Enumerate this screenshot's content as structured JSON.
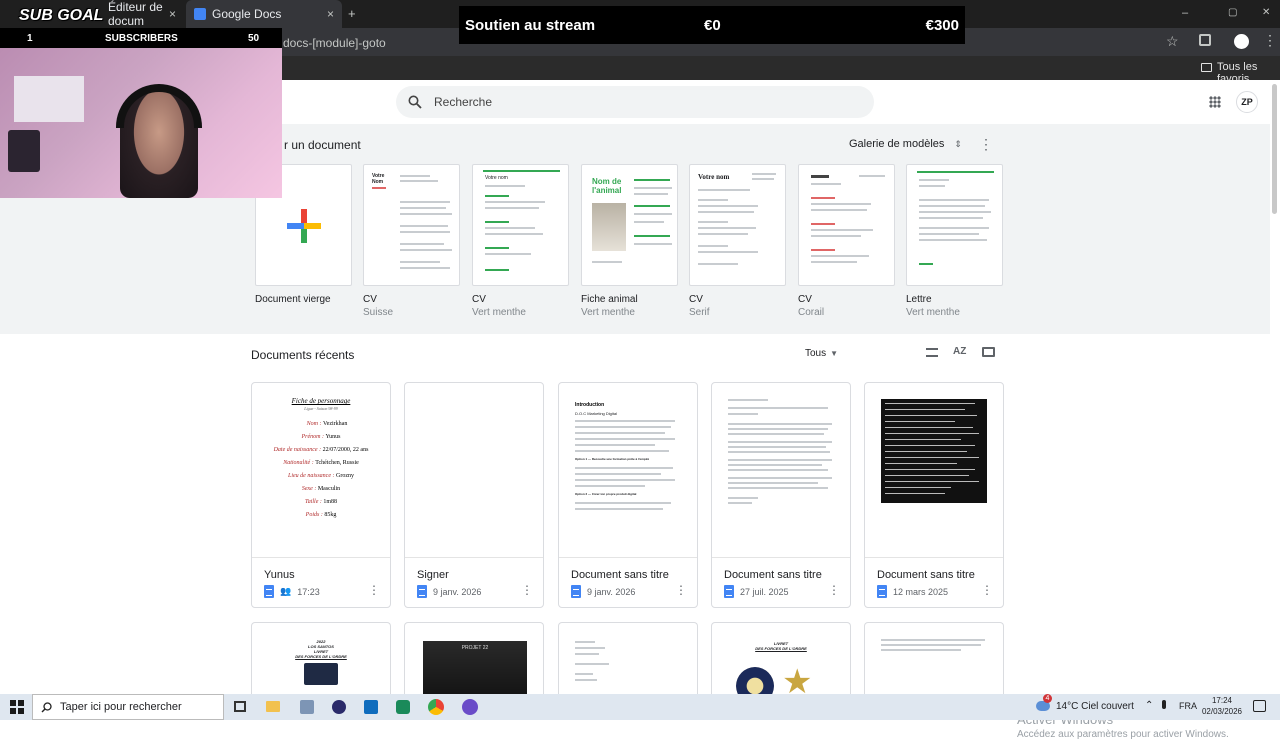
{
  "browser": {
    "tabs": [
      {
        "label": "Éditeur de docum",
        "close": "×"
      },
      {
        "label": "Google Docs",
        "close": "×"
      }
    ],
    "new_tab": "+",
    "url": "docs-[module]-goto",
    "bookmarks_label": "Tous les favoris",
    "window_controls": [
      "–",
      "▢",
      "✕"
    ]
  },
  "docs": {
    "search_placeholder": "Recherche",
    "new_doc_heading": "r un document",
    "gallery_label": "Galerie de modèles",
    "templates": [
      {
        "name": "Document vierge",
        "sub": ""
      },
      {
        "name": "CV",
        "sub": "Suisse"
      },
      {
        "name": "CV",
        "sub": "Vert menthe"
      },
      {
        "name": "Fiche animal",
        "sub": "Vert menthe"
      },
      {
        "name": "CV",
        "sub": "Serif"
      },
      {
        "name": "CV",
        "sub": "Corail"
      },
      {
        "name": "Lettre",
        "sub": "Vert menthe"
      }
    ],
    "template_previews": {
      "cv_suisse_title": "Votre Nom",
      "cv_vert_title": "Votre nom",
      "fiche_title": "Nom de l'animal",
      "cv_serif_title": "Votre nom"
    },
    "recent_heading": "Documents récents",
    "filter_label": "Tous",
    "sort_icon_label": "AZ",
    "recent_docs": [
      {
        "title": "Yunus",
        "date": "17:23",
        "shared": true
      },
      {
        "title": "Signer",
        "date": "9 janv. 2026",
        "shared": false
      },
      {
        "title": "Document sans titre",
        "date": "9 janv. 2026",
        "shared": false
      },
      {
        "title": "Document sans titre",
        "date": "27 juil. 2025",
        "shared": false
      },
      {
        "title": "Document sans titre",
        "date": "12 mars 2025",
        "shared": false
      }
    ],
    "yunus_preview": {
      "heading": "Fiche de personnage",
      "subheading": "Ligue - Saison 98-99",
      "lines": [
        {
          "k": "Nom :",
          "v": "Vezirkhan"
        },
        {
          "k": "Prénom :",
          "v": "Yunus"
        },
        {
          "k": "Date de naissance :",
          "v": "22/07/2000, 22 ans"
        },
        {
          "k": "Nationalité :",
          "v": "Tchétchen, Russie"
        },
        {
          "k": "Lieu de naissance :",
          "v": "Grozny"
        },
        {
          "k": "Sexe :",
          "v": "Masculin"
        },
        {
          "k": "Taille :",
          "v": "1m88"
        },
        {
          "k": "Poids :",
          "v": "85kg"
        }
      ]
    },
    "doc3_preview": {
      "heading": "Introduction",
      "subheading": "D.O.C Marketing Digital",
      "option1": "Option 1 — Recoudre une formation prête à l'emploi",
      "option2": "Option 2 — Créer ton propre produit digital"
    },
    "second_row_preview": {
      "card1_lines": [
        "2022",
        "LOS SANTOS",
        "LIVRET",
        "DES FORCES DE L'ORDRE"
      ],
      "card2_label": "PROJET 22",
      "card4_lines": [
        "LIVRET",
        "DES FORCES DE L'ORDRE"
      ]
    },
    "watermark_title": "Activer Windows",
    "watermark_sub": "Accédez aux paramètres pour activer Windows."
  },
  "overlay": {
    "subgoal_title": "SUB GOAL",
    "subgoal_current": "1",
    "subgoal_label": "SUBSCRIBERS",
    "subgoal_target": "50",
    "stream_title": "Soutien au stream",
    "stream_current": "€0",
    "stream_goal": "€300"
  },
  "taskbar": {
    "search_placeholder": "Taper ici pour rechercher",
    "weather": "14°C  Ciel couvert",
    "lang": "FRA",
    "time": "17:24",
    "date": "02/03/2026",
    "notification_count": "4"
  },
  "colors": {
    "docs_blue": "#4285f4",
    "template_bg": "#f1f3f4",
    "mint": "#34a853",
    "coral": "#e06666"
  }
}
